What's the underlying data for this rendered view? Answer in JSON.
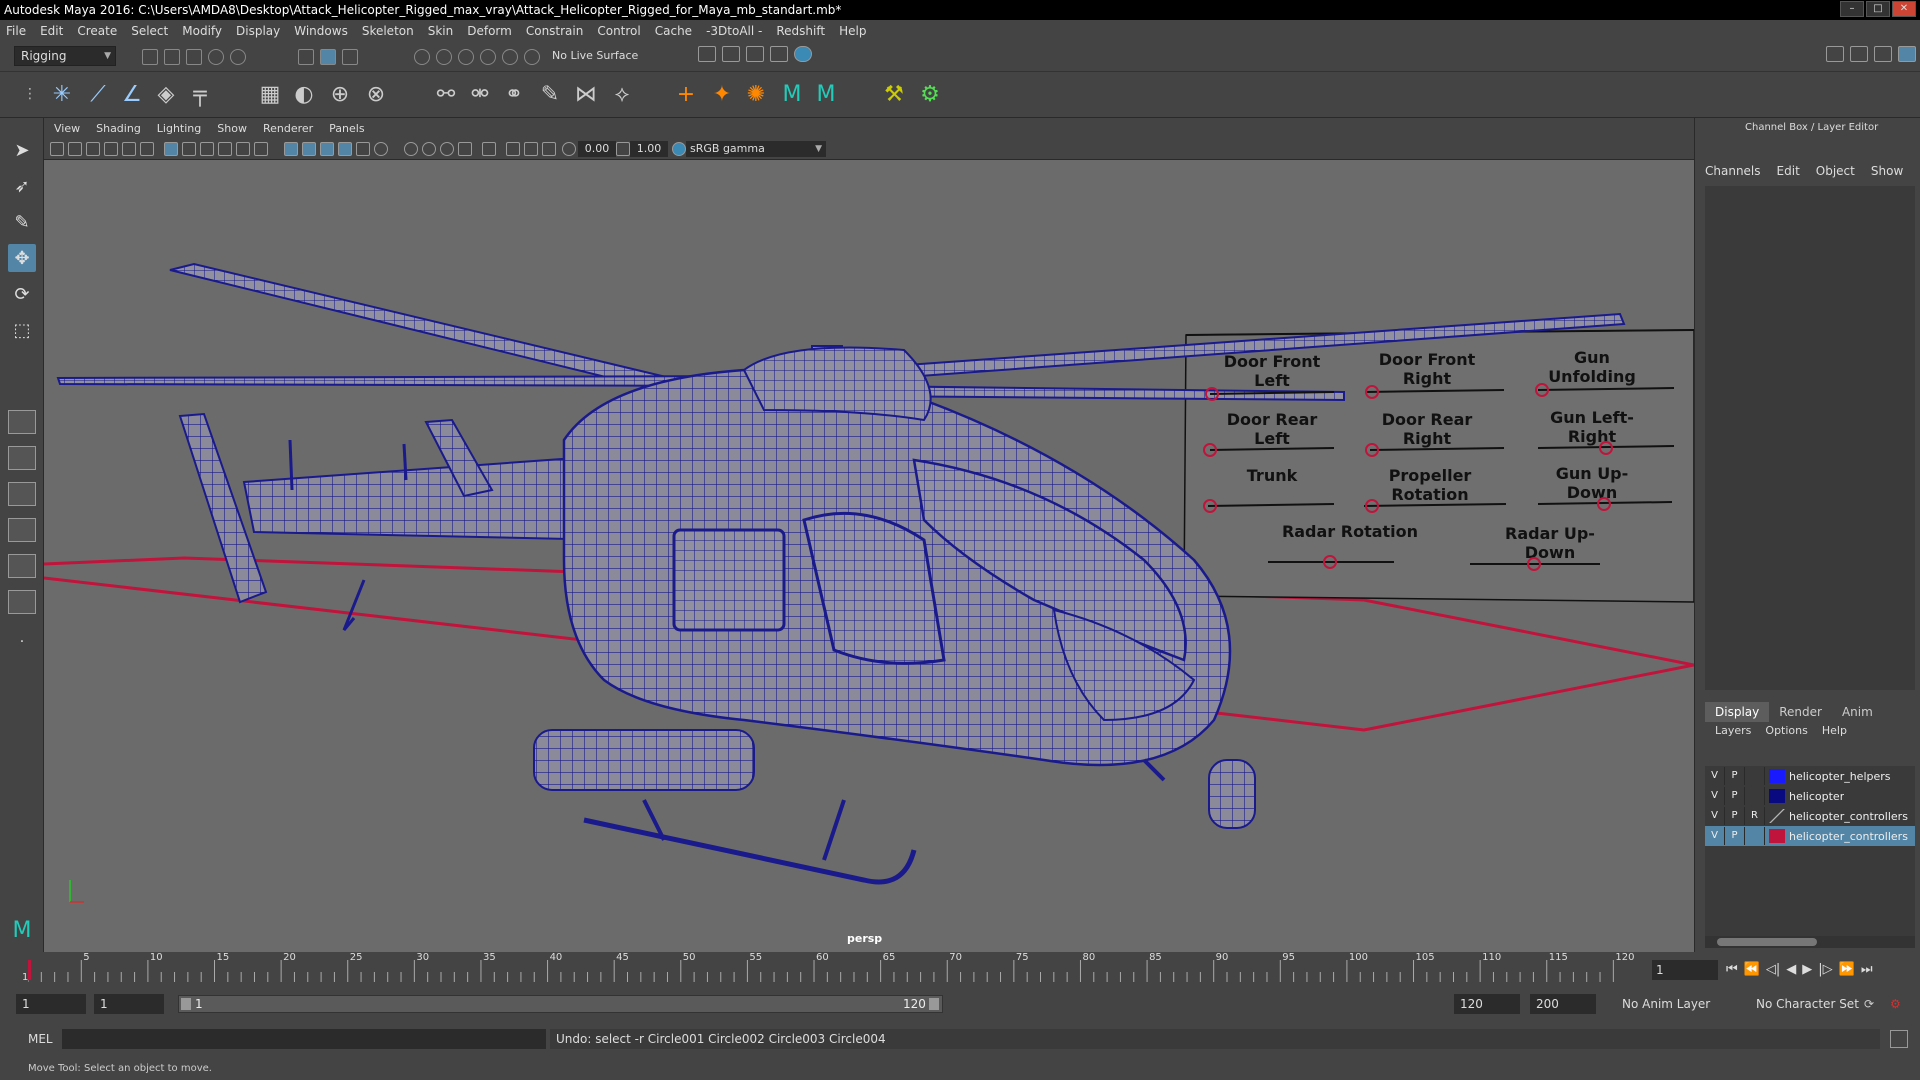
{
  "window": {
    "title": "Autodesk Maya 2016: C:\\Users\\AMDA8\\Desktop\\Attack_Helicopter_Rigged_max_vray\\Attack_Helicopter_Rigged_for_Maya_mb_standart.mb*",
    "min": "–",
    "max": "□",
    "close": "✕"
  },
  "menubar": [
    "File",
    "Edit",
    "Create",
    "Select",
    "Modify",
    "Display",
    "Windows",
    "Skeleton",
    "Skin",
    "Deform",
    "Constrain",
    "Control",
    "Cache",
    "-3DtoAll -",
    "Redshift",
    "Help"
  ],
  "status_line": {
    "menu_set": "Rigging",
    "live_surface": "No Live Surface"
  },
  "viewport": {
    "menu": [
      "View",
      "Shading",
      "Lighting",
      "Show",
      "Renderer",
      "Panels"
    ],
    "exposure": "0.00",
    "gamma": "1.00",
    "color_space": "sRGB gamma",
    "camera_label": "persp"
  },
  "controls_board": {
    "labels": [
      "Door Front Left",
      "Door Front Right",
      "Gun Unfolding",
      "Door Rear Left",
      "Door Rear Right",
      "Gun Left-Right",
      "Trunk",
      "Propeller Rotation",
      "Gun Up-Down",
      "Radar Rotation",
      "Radar Up-Down"
    ]
  },
  "channel_box": {
    "title": "Channel Box / Layer Editor",
    "menu": [
      "Channels",
      "Edit",
      "Object",
      "Show"
    ]
  },
  "layer_editor": {
    "tabs": [
      "Display",
      "Render",
      "Anim"
    ],
    "menu": [
      "Layers",
      "Options",
      "Help"
    ],
    "layers": [
      {
        "v": "V",
        "p": "P",
        "r": "",
        "color": "#1a1aff",
        "name": "helicopter_helpers"
      },
      {
        "v": "V",
        "p": "P",
        "r": "",
        "color": "#0a0a80",
        "name": "helicopter"
      },
      {
        "v": "V",
        "p": "P",
        "r": "R",
        "color": "",
        "name": "helicopter_controllers"
      },
      {
        "v": "V",
        "p": "P",
        "r": "",
        "color": "#c0143c",
        "name": "helicopter_controllers"
      }
    ]
  },
  "time_slider": {
    "ticks": [
      "5",
      "10",
      "15",
      "20",
      "25",
      "30",
      "35",
      "40",
      "45",
      "50",
      "55",
      "60",
      "65",
      "70",
      "75",
      "80",
      "85",
      "90",
      "95",
      "100",
      "105",
      "110",
      "115",
      "120"
    ],
    "start_tick": "1",
    "current_frame": "1"
  },
  "range_slider": {
    "start": "1",
    "inner_start": "1",
    "range_start_label": "1",
    "range_end_label": "120",
    "end": "120",
    "anim_end": "200",
    "anim_layer": "No Anim Layer",
    "character_set": "No Character Set"
  },
  "command_line": {
    "language": "MEL",
    "result": "Undo: select -r Circle001 Circle002 Circle003 Circle004"
  },
  "help_line": "Move Tool: Select an object to move.",
  "colors": {
    "wire": "#1a1a8c",
    "rig": "#c0143c",
    "accent": "#5285a6"
  }
}
